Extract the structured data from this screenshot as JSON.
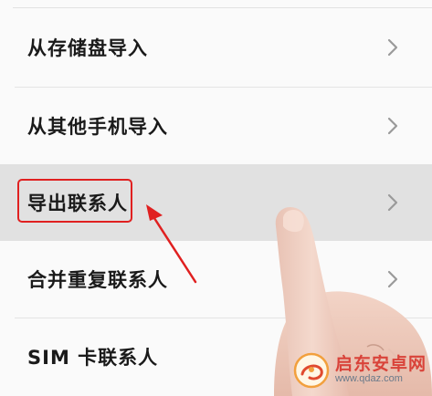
{
  "menu": {
    "items": [
      {
        "label": "从存储盘导入",
        "icon": "chevron-right-icon"
      },
      {
        "label": "从其他手机导入",
        "icon": "chevron-right-icon"
      },
      {
        "label": "导出联系人",
        "icon": "chevron-right-icon",
        "highlighted": true
      },
      {
        "label": "合并重复联系人",
        "icon": "chevron-right-icon"
      },
      {
        "label": "SIM 卡联系人",
        "icon": "chevron-right-icon"
      }
    ]
  },
  "annotation": {
    "color": "#e02020",
    "target_label": "导出联系人"
  },
  "watermark": {
    "name": "启东安卓网",
    "url": "www.qdaz.com"
  },
  "colors": {
    "background": "#fafafa",
    "pressed_row": "#e1e1e1",
    "text": "#1a1a1a",
    "chevron": "#9a9a9a",
    "annotation": "#e02020"
  }
}
